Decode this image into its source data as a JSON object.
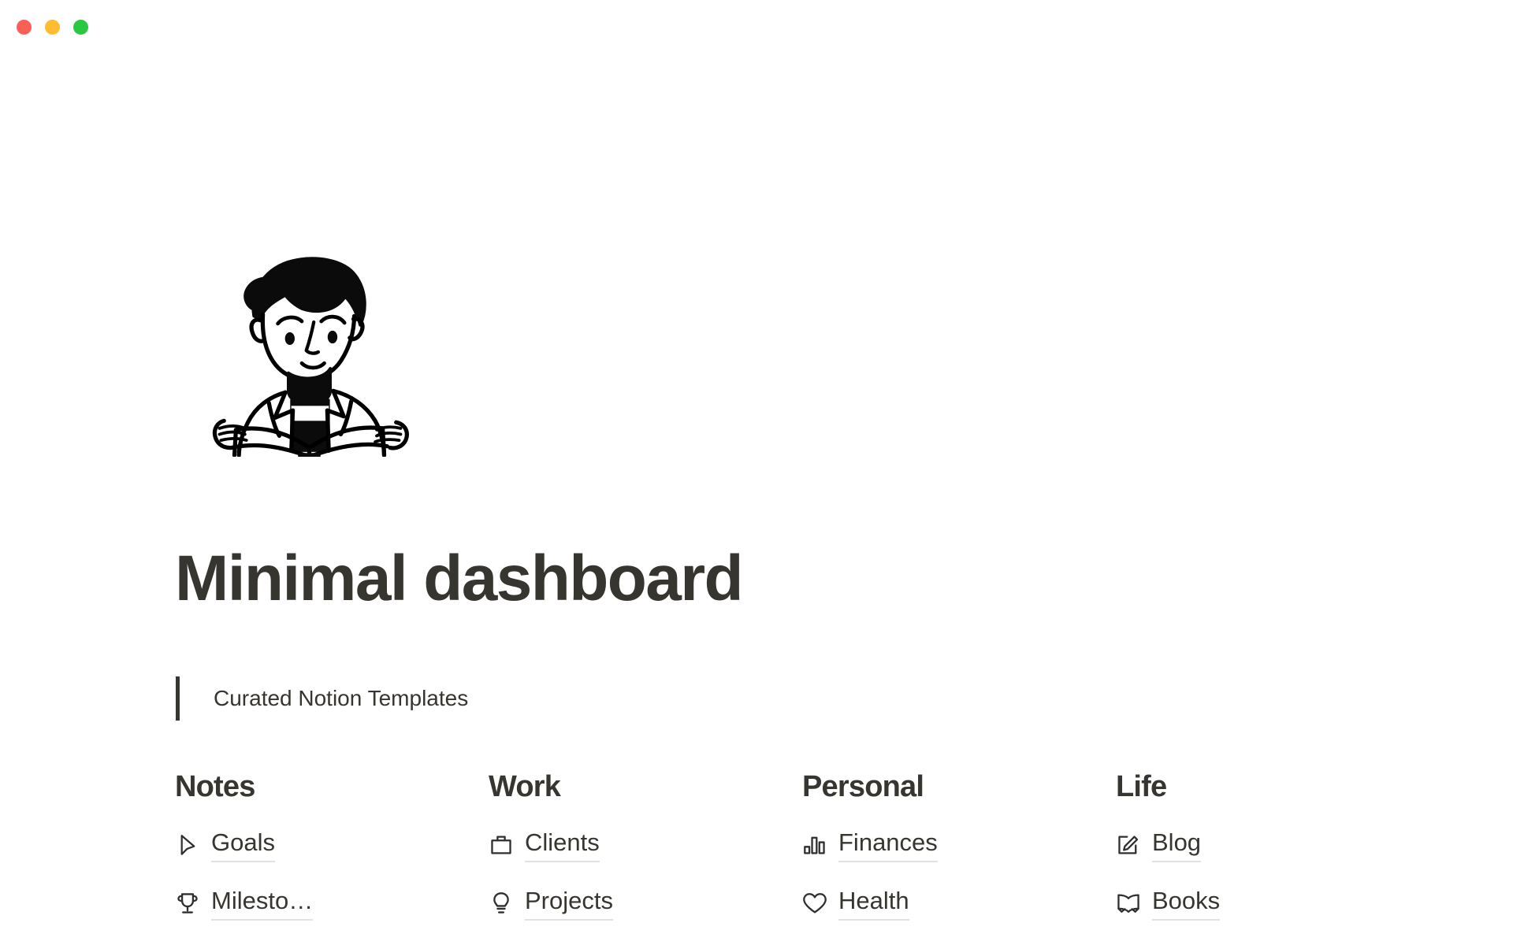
{
  "window": {
    "controls": [
      {
        "name": "close-button",
        "color": "#FC5F57"
      },
      {
        "name": "minimize-button",
        "color": "#FEBC2E"
      },
      {
        "name": "maximize-button",
        "color": "#28C840"
      }
    ]
  },
  "cover": {
    "icon": "person-reading-book-illustration",
    "alt": "Line illustration of a person reading an open book"
  },
  "header": {
    "title": "Minimal dashboard",
    "quote": "Curated Notion Templates",
    "title_color": "#37352F"
  },
  "columns": [
    {
      "title": "Notes",
      "items": [
        {
          "label": "Goals",
          "icon": "cursor-arrow-icon"
        },
        {
          "label": "Milesto…",
          "icon": "trophy-icon"
        }
      ]
    },
    {
      "title": "Work",
      "items": [
        {
          "label": "Clients",
          "icon": "briefcase-icon"
        },
        {
          "label": "Projects",
          "icon": "lightbulb-icon"
        }
      ]
    },
    {
      "title": "Personal",
      "items": [
        {
          "label": "Finances",
          "icon": "bar-chart-icon"
        },
        {
          "label": "Health",
          "icon": "heart-icon"
        }
      ]
    },
    {
      "title": "Life",
      "items": [
        {
          "label": "Blog",
          "icon": "pencil-square-icon"
        },
        {
          "label": "Books",
          "icon": "open-book-icon"
        }
      ]
    }
  ]
}
